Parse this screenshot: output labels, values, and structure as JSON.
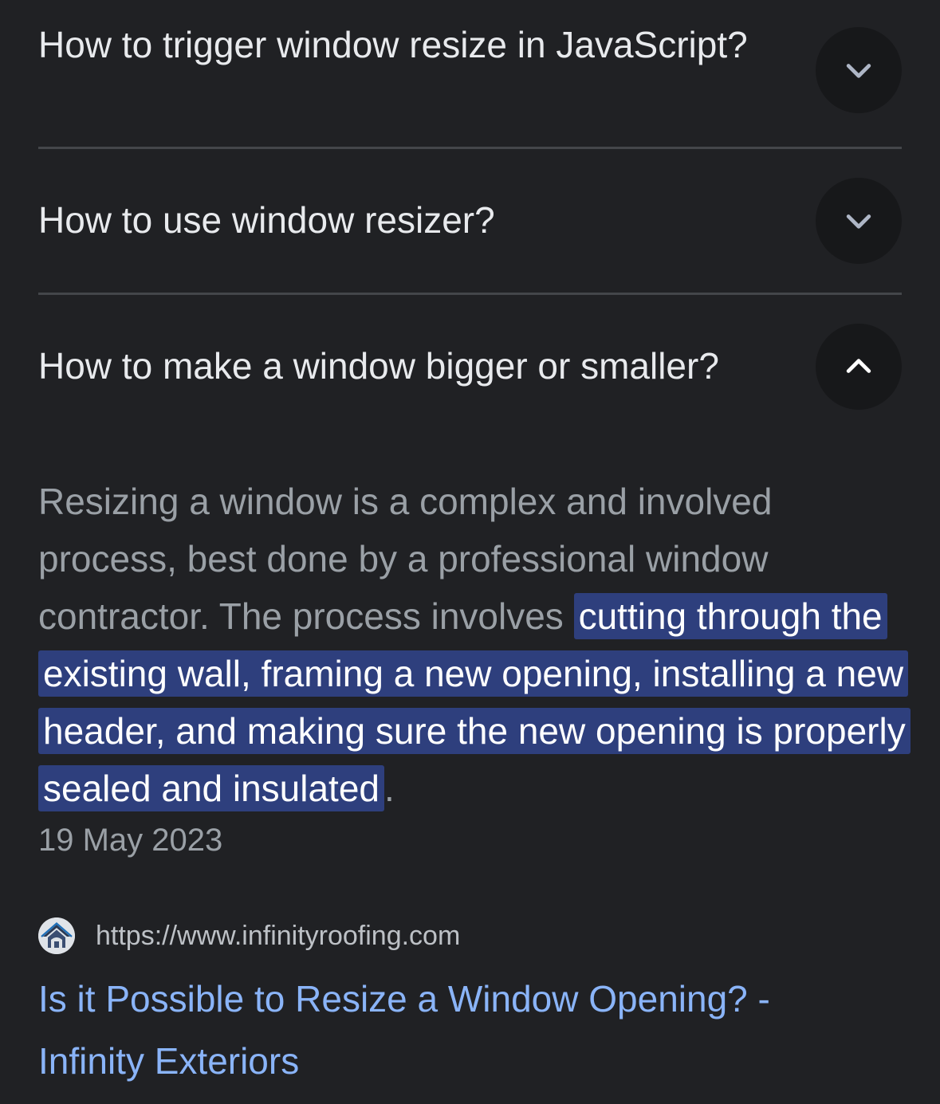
{
  "faq": {
    "items": [
      {
        "question": "How to trigger window resize in JavaScript?",
        "expanded": false,
        "toggle_icon": "chevron-down-icon"
      },
      {
        "question": "How to use window resizer?",
        "expanded": false,
        "toggle_icon": "chevron-down-icon"
      },
      {
        "question": "How to make a window bigger or smaller?",
        "expanded": true,
        "toggle_icon": "chevron-up-icon"
      }
    ]
  },
  "answer": {
    "text_before": "Resizing a window is a complex and involved process, best done by a professional window contractor. The process involves ",
    "highlighted": "cutting through the existing wall, framing a new opening, installing a new header, and making sure the new opening is properly sealed and insulated",
    "text_after": ".",
    "date": "19 May 2023"
  },
  "source": {
    "favicon_icon": "house-logo-icon",
    "url": "https://www.infinityroofing.com",
    "title": "Is it Possible to Resize a Window Opening? - Infinity Exteriors"
  },
  "colors": {
    "background": "#202124",
    "question_text": "#e8eaed",
    "answer_text": "#9aa0a6",
    "highlight_bg": "#2e3f7d",
    "link": "#8ab4f8",
    "toggle_bg": "#17181a",
    "divider": "#44464a"
  }
}
